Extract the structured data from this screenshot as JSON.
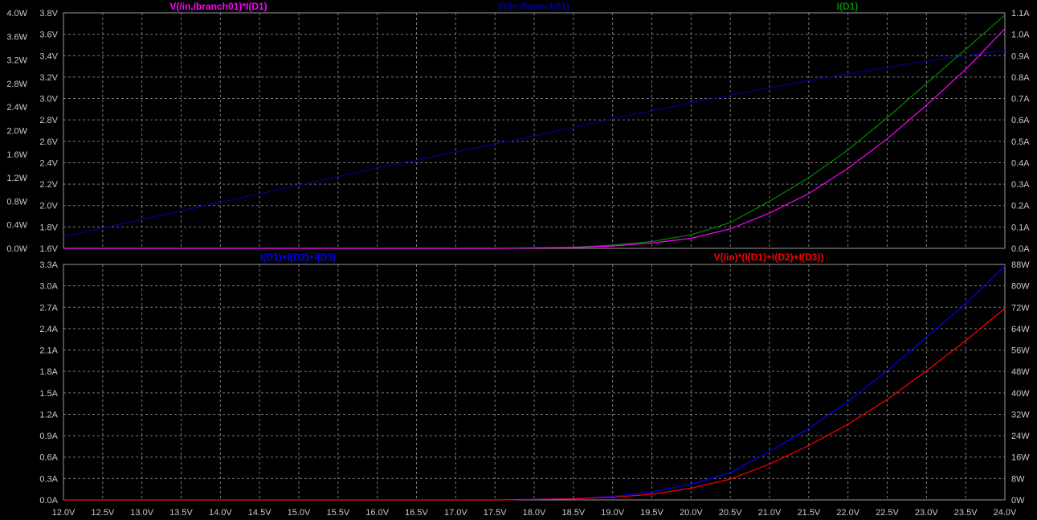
{
  "colors": {
    "background": "#000000",
    "grid": "#7a7a7a",
    "frame": "#9a9a9a",
    "tick_text": "#c8c8c8"
  },
  "chart_data": [
    {
      "type": "line",
      "titles": [
        {
          "text": "V(/in,/branch01)*I(D1)",
          "color": "#ff00ff",
          "align": "left"
        },
        {
          "text": "V(/in,/branch01)",
          "color": "#000099",
          "align": "center"
        },
        {
          "text": "I(D1)",
          "color": "#008800",
          "align": "right"
        }
      ],
      "xlim": [
        12,
        24
      ],
      "grid": true,
      "left_axis_outer": {
        "ticks": [
          "0.0W",
          "0.4W",
          "0.8W",
          "1.2W",
          "1.6W",
          "2.0W",
          "2.4W",
          "2.8W",
          "3.2W",
          "3.6W",
          "4.0W"
        ]
      },
      "left_axis_inner": {
        "ticks": [
          "1.6V",
          "1.8V",
          "2.0V",
          "2.2V",
          "2.4V",
          "2.6V",
          "2.8V",
          "3.0V",
          "3.2V",
          "3.4V",
          "3.6V",
          "3.8V"
        ]
      },
      "right_axis": {
        "ticks": [
          "0.0A",
          "0.1A",
          "0.2A",
          "0.3A",
          "0.4A",
          "0.5A",
          "0.6A",
          "0.7A",
          "0.8A",
          "0.9A",
          "1.0A",
          "1.1A"
        ]
      },
      "series": [
        {
          "name": "V(/in,/branch01)",
          "color": "#000099",
          "axis": "inner",
          "ylim": [
            1.6,
            3.8
          ],
          "x": [
            12,
            13,
            14,
            15,
            16,
            17,
            18,
            19,
            20,
            21,
            22,
            23,
            24
          ],
          "y": [
            1.71,
            1.87,
            2.03,
            2.19,
            2.35,
            2.5,
            2.65,
            2.81,
            2.96,
            3.1,
            3.23,
            3.35,
            3.45
          ]
        },
        {
          "name": "I(D1)",
          "color": "#008800",
          "axis": "right",
          "ylim": [
            0,
            1.1
          ],
          "x": [
            12,
            17.5,
            18.5,
            19.0,
            19.5,
            20.0,
            20.5,
            21.0,
            21.5,
            22.0,
            22.5,
            23.0,
            23.5,
            24.0
          ],
          "y": [
            0.0,
            0.0,
            0.005,
            0.015,
            0.032,
            0.063,
            0.12,
            0.22,
            0.33,
            0.46,
            0.61,
            0.77,
            0.93,
            1.09
          ]
        },
        {
          "name": "V(/in,/branch01)*I(D1)",
          "color": "#ff00ff",
          "axis": "outer",
          "ylim": [
            0,
            4.0
          ],
          "x": [
            12,
            17.5,
            18.5,
            19.0,
            19.5,
            20.0,
            20.5,
            21.0,
            21.5,
            22.0,
            22.5,
            23.0,
            23.5,
            24.0
          ],
          "y": [
            0.0,
            0.0,
            0.014,
            0.04,
            0.09,
            0.17,
            0.33,
            0.6,
            0.93,
            1.36,
            1.86,
            2.43,
            3.04,
            3.73
          ]
        }
      ]
    },
    {
      "type": "line",
      "titles": [
        {
          "text": "I(D1)+I(D2)+I(D3)",
          "color": "#0000ff",
          "align": "center-left"
        },
        {
          "text": "V(/in)*(I(D1)+I(D2)+I(D3))",
          "color": "#ff0000",
          "align": "center-right"
        }
      ],
      "xlim": [
        12,
        24
      ],
      "xlabels": [
        "12.0V",
        "12.5V",
        "13.0V",
        "13.5V",
        "14.0V",
        "14.5V",
        "15.0V",
        "15.5V",
        "16.0V",
        "16.5V",
        "17.0V",
        "17.5V",
        "18.0V",
        "18.5V",
        "19.0V",
        "19.5V",
        "20.0V",
        "20.5V",
        "21.0V",
        "21.5V",
        "22.0V",
        "22.5V",
        "23.0V",
        "23.5V",
        "24.0V"
      ],
      "grid": true,
      "left_axis": {
        "ticks": [
          "0.0A",
          "0.3A",
          "0.6A",
          "0.9A",
          "1.2A",
          "1.5A",
          "1.8A",
          "2.1A",
          "2.4A",
          "2.7A",
          "3.0A",
          "3.3A"
        ]
      },
      "right_axis": {
        "ticks": [
          "0W",
          "8W",
          "16W",
          "24W",
          "32W",
          "40W",
          "48W",
          "56W",
          "64W",
          "72W",
          "80W",
          "88W"
        ]
      },
      "series": [
        {
          "name": "I(D1)+I(D2)+I(D3)",
          "color": "#0000ff",
          "axis": "left",
          "ylim": [
            0,
            3.3
          ],
          "x": [
            12,
            17.5,
            18.5,
            19.0,
            19.5,
            20.0,
            20.5,
            21.0,
            21.5,
            22.0,
            22.5,
            23.0,
            23.5,
            24.0
          ],
          "y": [
            0.0,
            0.0,
            0.02,
            0.05,
            0.11,
            0.22,
            0.38,
            0.68,
            1.0,
            1.38,
            1.81,
            2.28,
            2.75,
            3.28
          ]
        },
        {
          "name": "V(/in)*(I(D1)+I(D2)+I(D3))",
          "color": "#ff0000",
          "axis": "right",
          "ylim": [
            0,
            88
          ],
          "x": [
            12,
            17.5,
            18.5,
            19.0,
            19.5,
            20.0,
            20.5,
            21.0,
            21.5,
            22.0,
            22.5,
            23.0,
            23.5,
            24.0
          ],
          "y": [
            0.0,
            0.0,
            0.4,
            1.0,
            2.1,
            4.4,
            7.8,
            13.4,
            20.3,
            28.3,
            37.5,
            48.2,
            59.5,
            71.6
          ]
        }
      ]
    }
  ]
}
